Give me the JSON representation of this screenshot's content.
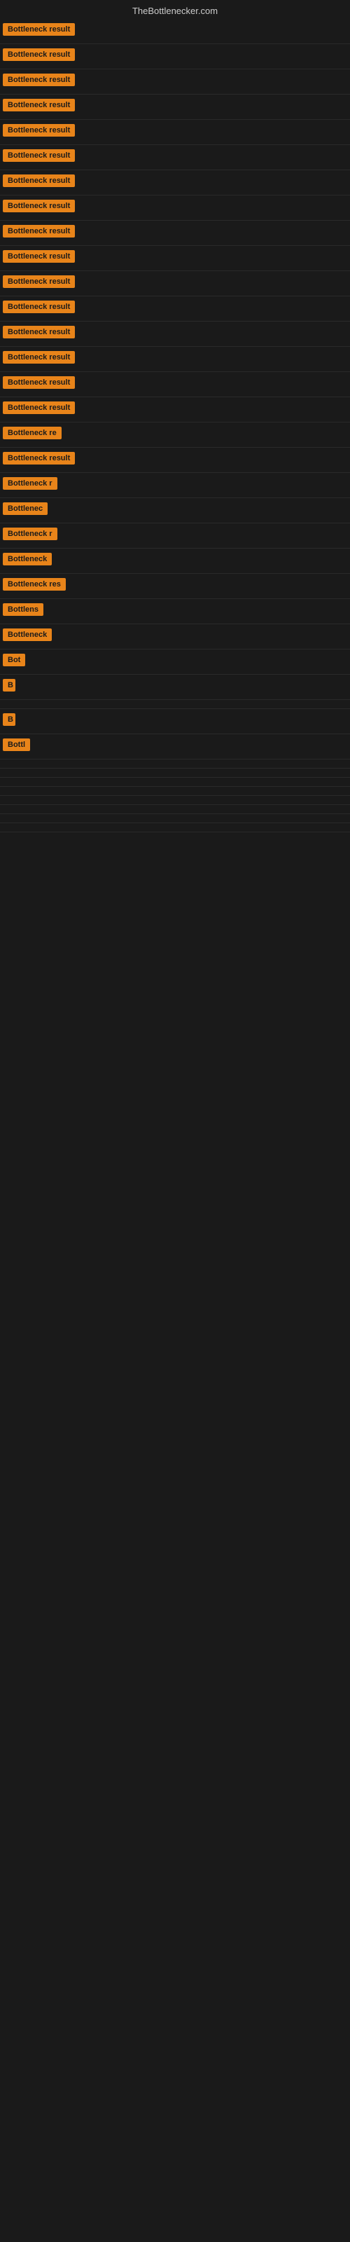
{
  "header": {
    "title": "TheBottlenecker.com"
  },
  "items": [
    {
      "label": "Bottleneck result",
      "label_width": 120
    },
    {
      "label": "Bottleneck result",
      "label_width": 120
    },
    {
      "label": "Bottleneck result",
      "label_width": 120
    },
    {
      "label": "Bottleneck result",
      "label_width": 120
    },
    {
      "label": "Bottleneck result",
      "label_width": 120
    },
    {
      "label": "Bottleneck result",
      "label_width": 120
    },
    {
      "label": "Bottleneck result",
      "label_width": 120
    },
    {
      "label": "Bottleneck result",
      "label_width": 120
    },
    {
      "label": "Bottleneck result",
      "label_width": 120
    },
    {
      "label": "Bottleneck result",
      "label_width": 120
    },
    {
      "label": "Bottleneck result",
      "label_width": 120
    },
    {
      "label": "Bottleneck result",
      "label_width": 120
    },
    {
      "label": "Bottleneck result",
      "label_width": 120
    },
    {
      "label": "Bottleneck result",
      "label_width": 120
    },
    {
      "label": "Bottleneck result",
      "label_width": 120
    },
    {
      "label": "Bottleneck result",
      "label_width": 120
    },
    {
      "label": "Bottleneck re",
      "label_width": 95
    },
    {
      "label": "Bottleneck result",
      "label_width": 120
    },
    {
      "label": "Bottleneck r",
      "label_width": 88
    },
    {
      "label": "Bottlenec",
      "label_width": 75
    },
    {
      "label": "Bottleneck r",
      "label_width": 88
    },
    {
      "label": "Bottleneck",
      "label_width": 78
    },
    {
      "label": "Bottleneck res",
      "label_width": 100
    },
    {
      "label": "Bottlens",
      "label_width": 65
    },
    {
      "label": "Bottleneck",
      "label_width": 72
    },
    {
      "label": "Bot",
      "label_width": 34
    },
    {
      "label": "B",
      "label_width": 18
    },
    {
      "label": "",
      "label_width": 0
    },
    {
      "label": "B",
      "label_width": 18
    },
    {
      "label": "Bottl",
      "label_width": 42
    },
    {
      "label": "",
      "label_width": 0
    },
    {
      "label": "",
      "label_width": 0
    },
    {
      "label": "",
      "label_width": 0
    },
    {
      "label": "",
      "label_width": 0
    },
    {
      "label": "",
      "label_width": 0
    },
    {
      "label": "",
      "label_width": 0
    },
    {
      "label": "",
      "label_width": 0
    },
    {
      "label": "",
      "label_width": 0
    }
  ]
}
